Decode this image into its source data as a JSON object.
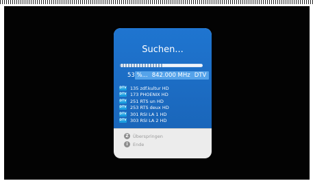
{
  "dialog": {
    "title": "Suchen...",
    "progress_percent": 53,
    "status": {
      "percent": "53 %...",
      "frequency": "842.000 MHz",
      "mode": "DTV"
    },
    "channels": [
      {
        "tag": "DTV",
        "name": "135 zdf.kultur HD"
      },
      {
        "tag": "DTV",
        "name": "173 PHOENIX HD"
      },
      {
        "tag": "DTV",
        "name": "251 RTS un HD"
      },
      {
        "tag": "DTV",
        "name": "253 RTS deux HD"
      },
      {
        "tag": "DTV",
        "name": "301 RSI LA 1 HD"
      },
      {
        "tag": "DTV",
        "name": "303 RSI LA 2 HD"
      }
    ],
    "keys": [
      {
        "key": "Z",
        "label": "Überspringen"
      },
      {
        "key": "i",
        "label": "Ende"
      }
    ]
  },
  "colors": {
    "panel_blue": "#1f75d0",
    "highlight_blue": "#55a3ea",
    "tag_blue": "#1b9fe0",
    "footer_grey": "#ececec"
  }
}
